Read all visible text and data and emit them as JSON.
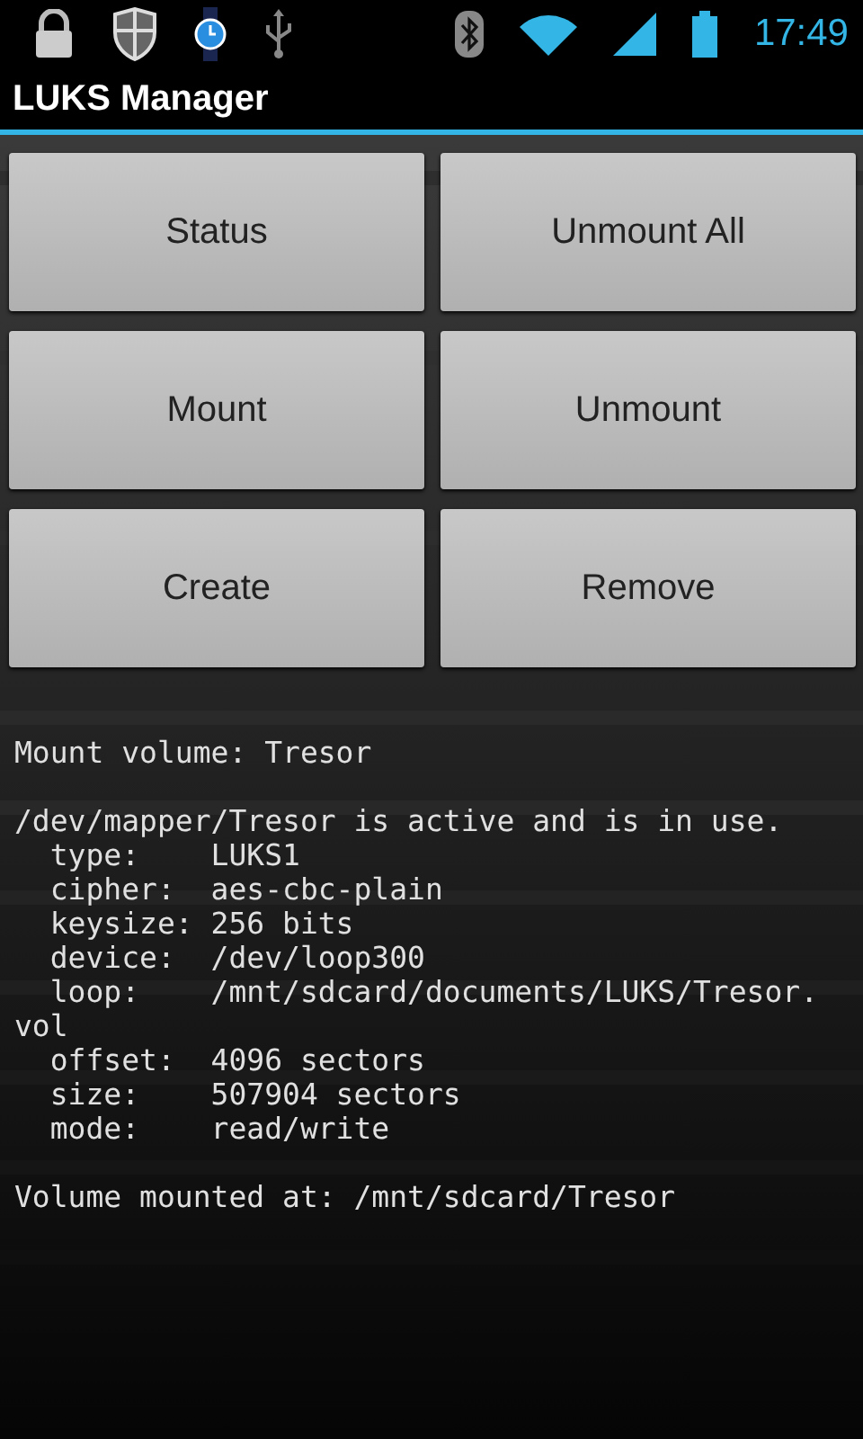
{
  "status_bar": {
    "time": "17:49"
  },
  "app_bar": {
    "title": "LUKS Manager"
  },
  "buttons": [
    {
      "label": "Status"
    },
    {
      "label": "Unmount All"
    },
    {
      "label": "Mount"
    },
    {
      "label": "Unmount"
    },
    {
      "label": "Create"
    },
    {
      "label": "Remove"
    }
  ],
  "output": {
    "blocks": [
      [
        "Mount volume: Tresor"
      ],
      [
        "/dev/mapper/Tresor is active and is in use.",
        "  type:    LUKS1",
        "  cipher:  aes-cbc-plain",
        "  keysize: 256 bits",
        "  device:  /dev/loop300",
        "  loop:    /mnt/sdcard/documents/LUKS/Tresor.",
        "vol",
        "  offset:  4096 sectors",
        "  size:    507904 sectors",
        "  mode:    read/write"
      ],
      [
        "Volume mounted at: /mnt/sdcard/Tresor"
      ]
    ]
  }
}
